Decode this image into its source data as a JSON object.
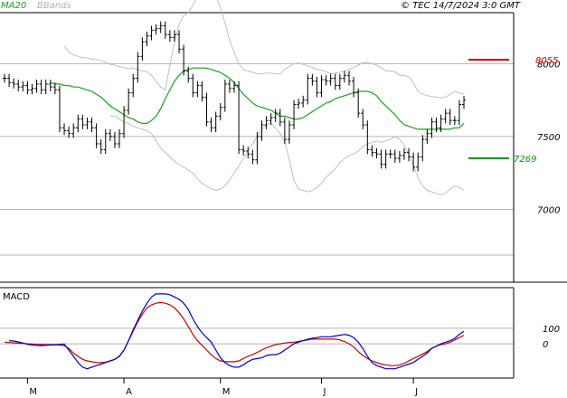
{
  "header": {
    "legend_ma": "MA20",
    "legend_bb": "BBands",
    "copyright": "© TEC 14/7/2024 3:0 GMT"
  },
  "colors": {
    "background": "#ffffff",
    "panel_bg": "#f0f0f0",
    "bars": "#000000",
    "ma20": "#1aa21a",
    "bbands": "#c0c0c0",
    "resistance": "#cc0000",
    "support": "#009900",
    "macd_line": "#0000cc",
    "signal_line": "#cc0000",
    "grid": "#b4b4b4"
  },
  "levels": {
    "resistance_label": "8055",
    "support_label": "7269"
  },
  "chart_data": [
    {
      "type": "ohlc",
      "title": "",
      "x": [
        "2024-02-22",
        "2024-02-23",
        "2024-02-26",
        "2024-02-27",
        "2024-02-28",
        "2024-02-29",
        "2024-03-01",
        "2024-03-04",
        "2024-03-05",
        "2024-03-06",
        "2024-03-07",
        "2024-03-08",
        "2024-03-11",
        "2024-03-12",
        "2024-03-13",
        "2024-03-14",
        "2024-03-15",
        "2024-03-18",
        "2024-03-19",
        "2024-03-20",
        "2024-03-21",
        "2024-03-22",
        "2024-03-25",
        "2024-03-26",
        "2024-03-27",
        "2024-03-28",
        "2024-04-01",
        "2024-04-02",
        "2024-04-03",
        "2024-04-04",
        "2024-04-05",
        "2024-04-08",
        "2024-04-09",
        "2024-04-10",
        "2024-04-11",
        "2024-04-12",
        "2024-04-15",
        "2024-04-16",
        "2024-04-17",
        "2024-04-18",
        "2024-04-19",
        "2024-04-22",
        "2024-04-23",
        "2024-04-24",
        "2024-04-25",
        "2024-04-26",
        "2024-04-29",
        "2024-04-30",
        "2024-05-01",
        "2024-05-02",
        "2024-05-03",
        "2024-05-06",
        "2024-05-07",
        "2024-05-08",
        "2024-05-09",
        "2024-05-10",
        "2024-05-13",
        "2024-05-14",
        "2024-05-15",
        "2024-05-16",
        "2024-05-17",
        "2024-05-20",
        "2024-05-21",
        "2024-05-22",
        "2024-05-23",
        "2024-05-24",
        "2024-05-27",
        "2024-05-28",
        "2024-05-29",
        "2024-05-30",
        "2024-05-31",
        "2024-06-03",
        "2024-06-04",
        "2024-06-05",
        "2024-06-06",
        "2024-06-07",
        "2024-06-10",
        "2024-06-11",
        "2024-06-12",
        "2024-06-13",
        "2024-06-14",
        "2024-06-17",
        "2024-06-18",
        "2024-06-19",
        "2024-06-20",
        "2024-06-21",
        "2024-06-24",
        "2024-06-25",
        "2024-06-26",
        "2024-06-27",
        "2024-06-28",
        "2024-07-01",
        "2024-07-02",
        "2024-07-03",
        "2024-07-04",
        "2024-07-05",
        "2024-07-08",
        "2024-07-09",
        "2024-07-10",
        "2024-07-11",
        "2024-07-12"
      ],
      "close": [
        7900,
        7870,
        7860,
        7840,
        7850,
        7820,
        7830,
        7860,
        7820,
        7860,
        7840,
        7820,
        7560,
        7540,
        7520,
        7560,
        7620,
        7580,
        7600,
        7560,
        7450,
        7410,
        7520,
        7500,
        7450,
        7520,
        7680,
        7800,
        7900,
        8050,
        8150,
        8190,
        8230,
        8240,
        8260,
        8200,
        8180,
        8200,
        8100,
        7950,
        7900,
        7800,
        7850,
        7770,
        7600,
        7560,
        7640,
        7700,
        7860,
        7830,
        7850,
        7410,
        7400,
        7380,
        7340,
        7500,
        7580,
        7610,
        7630,
        7660,
        7600,
        7480,
        7580,
        7720,
        7730,
        7750,
        7900,
        7880,
        7800,
        7890,
        7880,
        7900,
        7850,
        7900,
        7920,
        7880,
        7800,
        7660,
        7580,
        7410,
        7390,
        7380,
        7310,
        7380,
        7380,
        7350,
        7370,
        7390,
        7360,
        7290,
        7360,
        7480,
        7520,
        7600,
        7560,
        7620,
        7660,
        7610,
        7610,
        7720,
        7750
      ],
      "ma20": [
        7870,
        7860,
        7860,
        7850,
        7850,
        7840,
        7840,
        7830,
        7820,
        7810,
        7790,
        7770,
        7740,
        7710,
        7690,
        7670,
        7650,
        7630,
        7620,
        7600,
        7590,
        7590,
        7610,
        7640,
        7690,
        7760,
        7820,
        7880,
        7920,
        7950,
        7960,
        7970,
        7970,
        7970,
        7970,
        7960,
        7950,
        7940,
        7920,
        7900,
        7870,
        7830,
        7790,
        7760,
        7730,
        7710,
        7700,
        7690,
        7680,
        7660,
        7640,
        7640,
        7630,
        7620,
        7620,
        7630,
        7650,
        7670,
        7690,
        7710,
        7730,
        7740,
        7760,
        7770,
        7780,
        7790,
        7800,
        7810,
        7810,
        7810,
        7800,
        7780,
        7740,
        7710,
        7680,
        7650,
        7610,
        7580,
        7570,
        7560,
        7550,
        7550,
        7550,
        7550,
        7550,
        7550,
        7550,
        7550,
        7560,
        7560,
        7590
      ],
      "bb_upper": [
        8120,
        8080,
        8060,
        8050,
        8040,
        8040,
        8030,
        8030,
        8020,
        8010,
        7995,
        7990,
        7980,
        7975,
        7965,
        7970,
        7960,
        7950,
        7945,
        7920,
        7880,
        7840,
        7820,
        7990,
        8150,
        8270,
        8330,
        8350,
        8400,
        8460,
        8520,
        8510,
        8490,
        8470,
        8380,
        8280,
        8160,
        8080,
        8000,
        7960,
        7950,
        7940,
        7930,
        7930,
        7935,
        7935,
        7930,
        7930,
        7960,
        7980,
        8000,
        8005,
        7995,
        7985,
        7975,
        7960,
        7955,
        7945,
        7930,
        7935,
        7940,
        7950,
        7960,
        7975,
        7990,
        8005,
        8010,
        8000,
        7990,
        7970,
        7950,
        7950,
        7945,
        7920,
        7920,
        7910,
        7870,
        7810,
        7790,
        7780,
        7775,
        7770,
        7765,
        7770,
        7790,
        7810,
        7800,
        7790
      ],
      "bb_lower": [
        7640,
        7640,
        7620,
        7600,
        7590,
        7570,
        7560,
        7550,
        7540,
        7520,
        7470,
        7420,
        7390,
        7360,
        7330,
        7310,
        7290,
        7270,
        7250,
        7210,
        7180,
        7160,
        7140,
        7130,
        7140,
        7160,
        7200,
        7250,
        7300,
        7350,
        7400,
        7450,
        7500,
        7550,
        7580,
        7590,
        7560,
        7520,
        7460,
        7340,
        7200,
        7140,
        7130,
        7120,
        7130,
        7150,
        7180,
        7220,
        7250,
        7280,
        7320,
        7350,
        7370,
        7380,
        7400,
        7430,
        7450,
        7460,
        7470,
        7460,
        7470,
        7480,
        7500,
        7480,
        7440,
        7380,
        7300,
        7220,
        7160,
        7130,
        7120,
        7110,
        7100,
        7110,
        7140,
        7160,
        7150,
        7130
      ],
      "yticks": [
        8000,
        7500,
        7000
      ],
      "ylim": [
        6500,
        8350
      ],
      "month_labels": [
        "M",
        "A",
        "M",
        "J",
        "J"
      ]
    },
    {
      "type": "line",
      "title": "MACD",
      "series": [
        {
          "values": [
            20,
            18,
            12,
            5,
            -3,
            -8,
            -10,
            -12,
            -10,
            -8,
            -6,
            -4,
            -2,
            -40,
            -80,
            -120,
            -150,
            -160,
            -150,
            -140,
            -130,
            -120,
            -110,
            -100,
            -80,
            -40,
            20,
            90,
            150,
            210,
            260,
            300,
            320,
            320,
            320,
            315,
            300,
            285,
            260,
            220,
            160,
            110,
            70,
            40,
            10,
            -40,
            -90,
            -120,
            -140,
            -150,
            -150,
            -135,
            -115,
            -100,
            -95,
            -90,
            -75,
            -70,
            -70,
            -60,
            -40,
            -20,
            0,
            10,
            20,
            30,
            35,
            40,
            45,
            45,
            45,
            50,
            55,
            60,
            55,
            40,
            10,
            -30,
            -80,
            -120,
            -140,
            -150,
            -160,
            -160,
            -160,
            -150,
            -140,
            -130,
            -120,
            -100,
            -80,
            -60,
            -30,
            -15,
            0,
            10,
            20,
            35,
            60,
            80
          ]
        },
        {
          "values": [
            10,
            8,
            6,
            4,
            2,
            0,
            -2,
            -4,
            -5,
            -6,
            -6,
            -7,
            -8,
            -12,
            -30,
            -60,
            -80,
            -100,
            -110,
            -115,
            -120,
            -120,
            -118,
            -110,
            -100,
            -80,
            -40,
            20,
            80,
            140,
            190,
            230,
            250,
            260,
            265,
            260,
            250,
            230,
            200,
            160,
            110,
            60,
            20,
            -10,
            -40,
            -70,
            -95,
            -110,
            -115,
            -115,
            -115,
            -110,
            -95,
            -80,
            -70,
            -55,
            -40,
            -25,
            -15,
            -5,
            0,
            5,
            8,
            10,
            15,
            20,
            25,
            30,
            30,
            30,
            30,
            30,
            30,
            25,
            15,
            0,
            -20,
            -50,
            -75,
            -95,
            -110,
            -120,
            -130,
            -135,
            -140,
            -140,
            -135,
            -125,
            -110,
            -95,
            -80,
            -65,
            -50,
            -30,
            -15,
            -5,
            0,
            10,
            25,
            40,
            55
          ]
        }
      ],
      "yticks": [
        100,
        0
      ],
      "ylim": [
        -220,
        360
      ]
    }
  ]
}
